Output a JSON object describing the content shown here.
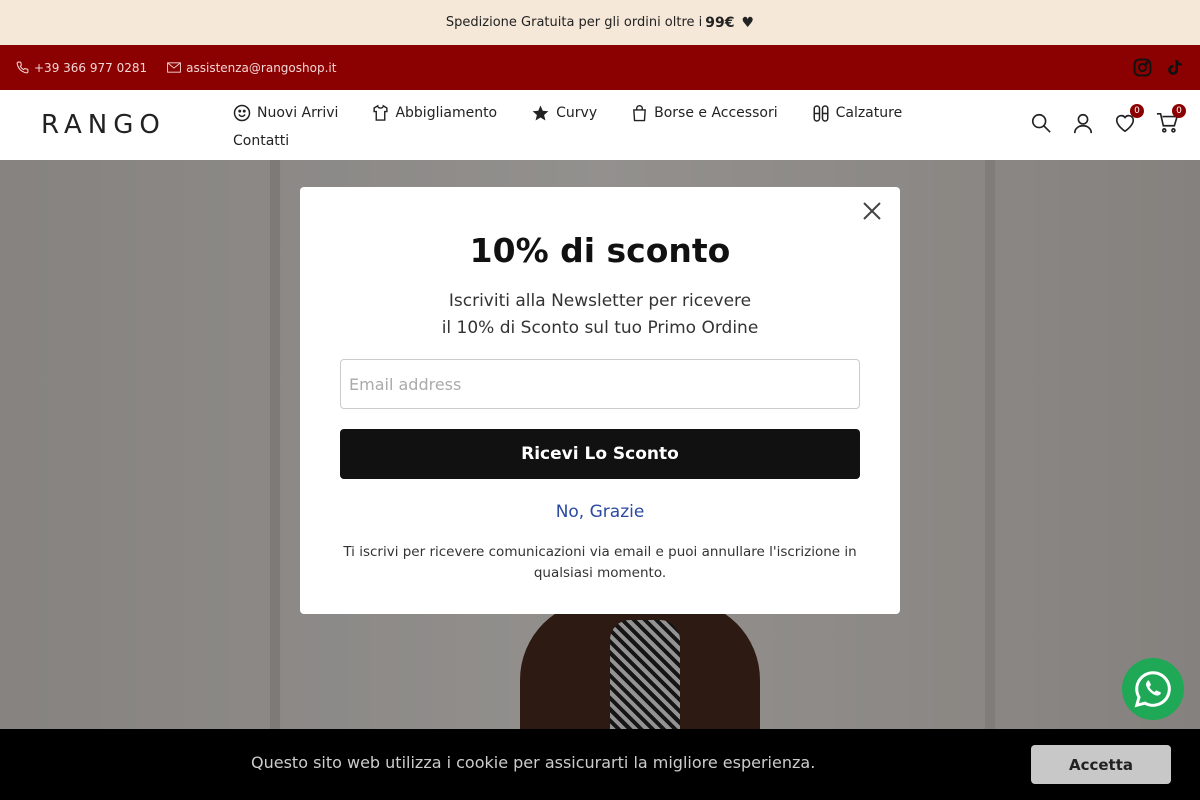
{
  "announcement": {
    "prefix": "Spedizione Gratuita per gli ordini oltre i",
    "amount": "99€",
    "icon": "heart-icon"
  },
  "contact": {
    "phone": "+39 366 977 0281",
    "email": "assistenza@rangoshop.it",
    "social": [
      "instagram-icon",
      "tiktok-icon"
    ]
  },
  "header": {
    "logo": "RANGO",
    "nav": [
      {
        "label": "Nuovi Arrivi",
        "icon": "smiley-icon"
      },
      {
        "label": "Abbigliamento",
        "icon": "shirt-icon"
      },
      {
        "label": "Curvy",
        "icon": "star-icon"
      },
      {
        "label": "Borse e Accessori",
        "icon": "bag-icon"
      },
      {
        "label": "Calzature",
        "icon": "shoes-icon"
      },
      {
        "label": "Contatti",
        "icon": ""
      }
    ],
    "wishlist_count": "0",
    "cart_count": "0"
  },
  "modal": {
    "title": "10% di sconto",
    "subtitle_line1": "Iscriviti alla Newsletter per ricevere",
    "subtitle_line2": "il 10% di Sconto sul tuo Primo Ordine",
    "email_placeholder": "Email address",
    "cta_label": "Ricevi Lo Sconto",
    "decline_label": "No, Grazie",
    "disclaimer": "Ti iscrivi per ricevere comunicazioni via email e puoi annullare l'iscrizione in qualsiasi momento."
  },
  "cookie": {
    "message": "Questo sito web utilizza i cookie per assicurarti la migliore esperienza.",
    "accept_label": "Accetta"
  },
  "colors": {
    "announce_bg": "#f6e8d8",
    "topbar_bg": "#8b0000",
    "whatsapp": "#1fa855",
    "decline_link": "#2a4aa0"
  }
}
